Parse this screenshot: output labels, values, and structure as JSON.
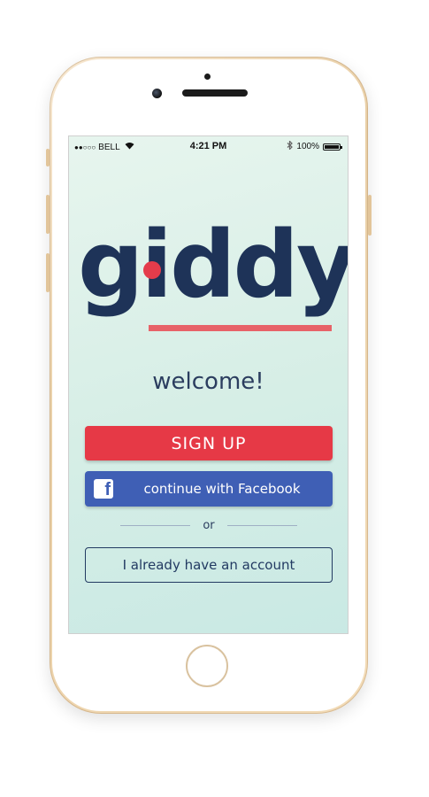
{
  "status_bar": {
    "carrier": "BELL",
    "signal_dots": "●●○○○",
    "time": "4:21 PM",
    "battery": "100%",
    "icons": [
      "wifi-icon",
      "bluetooth-icon",
      "battery-icon"
    ]
  },
  "logo": {
    "text": "giddy",
    "colors": {
      "text": "#1e3358",
      "dot": "#e43c4b",
      "underline": "#e8525a"
    }
  },
  "welcome": "welcome!",
  "buttons": {
    "signup": "SIGN UP",
    "facebook": "continue with Facebook",
    "facebook_icon": "f",
    "account": "I already have an account"
  },
  "divider_text": "or",
  "colors": {
    "signup_bg": "#e63946",
    "facebook_bg": "#3f5fb5",
    "navy": "#223a62",
    "screen_bg": "#d6eee6"
  }
}
